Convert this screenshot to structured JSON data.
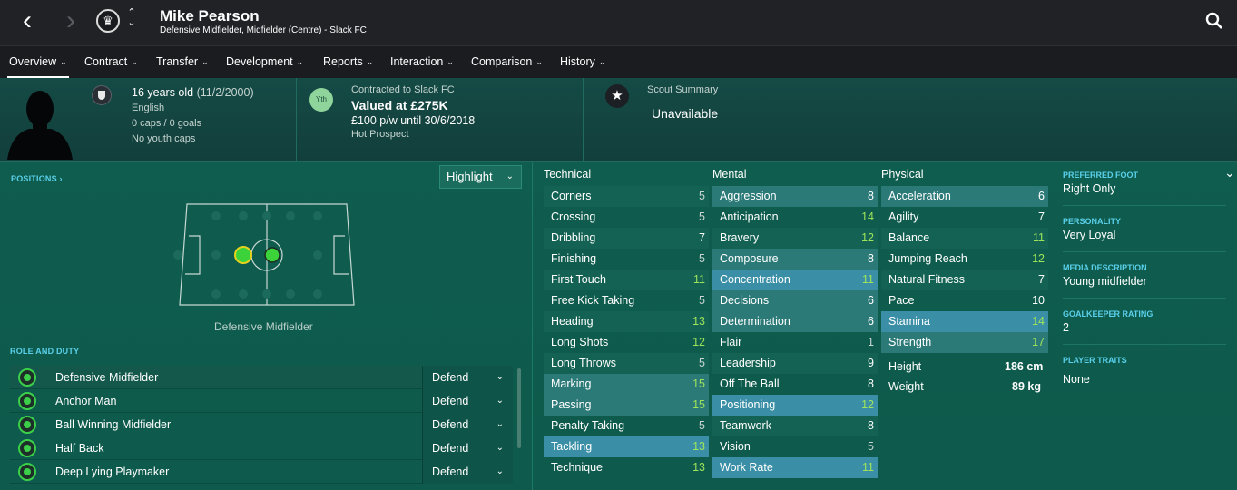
{
  "header": {
    "player_name": "Mike Pearson",
    "subtitle": "Defensive Midfielder, Midfielder (Centre) - Slack FC"
  },
  "tabs": [
    {
      "label": "Overview"
    },
    {
      "label": "Contract"
    },
    {
      "label": "Transfer"
    },
    {
      "label": "Development"
    },
    {
      "label": "Reports"
    },
    {
      "label": "Interaction"
    },
    {
      "label": "Comparison"
    },
    {
      "label": "History"
    }
  ],
  "info": {
    "age": "16 years old",
    "dob": "(11/2/2000)",
    "nationality": "English",
    "caps": "0 caps / 0 goals",
    "youth_caps": "No youth caps",
    "contract_label": "Contracted to Slack FC",
    "value": "Valued at £275K",
    "wage": "£100 p/w until 30/6/2018",
    "status": "Hot Prospect",
    "yth_badge": "Yth",
    "scout_label": "Scout Summary",
    "scout_value": "Unavailable"
  },
  "positions": {
    "heading": "POSITIONS",
    "highlight_label": "Highlight",
    "position_label": "Defensive Midfielder"
  },
  "roles": {
    "heading": "ROLE AND DUTY",
    "items": [
      {
        "name": "Defensive Midfielder",
        "duty": "Defend"
      },
      {
        "name": "Anchor Man",
        "duty": "Defend"
      },
      {
        "name": "Ball Winning Midfielder",
        "duty": "Defend"
      },
      {
        "name": "Half Back",
        "duty": "Defend"
      },
      {
        "name": "Deep Lying Playmaker",
        "duty": "Defend"
      }
    ]
  },
  "attributes": {
    "technical_heading": "Technical",
    "mental_heading": "Mental",
    "physical_heading": "Physical",
    "technical": [
      {
        "name": "Corners",
        "value": "5"
      },
      {
        "name": "Crossing",
        "value": "5"
      },
      {
        "name": "Dribbling",
        "value": "7"
      },
      {
        "name": "Finishing",
        "value": "5"
      },
      {
        "name": "First Touch",
        "value": "11"
      },
      {
        "name": "Free Kick Taking",
        "value": "5"
      },
      {
        "name": "Heading",
        "value": "13"
      },
      {
        "name": "Long Shots",
        "value": "12"
      },
      {
        "name": "Long Throws",
        "value": "5"
      },
      {
        "name": "Marking",
        "value": "15"
      },
      {
        "name": "Passing",
        "value": "15"
      },
      {
        "name": "Penalty Taking",
        "value": "5"
      },
      {
        "name": "Tackling",
        "value": "13"
      },
      {
        "name": "Technique",
        "value": "13"
      }
    ],
    "mental": [
      {
        "name": "Aggression",
        "value": "8"
      },
      {
        "name": "Anticipation",
        "value": "14"
      },
      {
        "name": "Bravery",
        "value": "12"
      },
      {
        "name": "Composure",
        "value": "8"
      },
      {
        "name": "Concentration",
        "value": "11"
      },
      {
        "name": "Decisions",
        "value": "6"
      },
      {
        "name": "Determination",
        "value": "6"
      },
      {
        "name": "Flair",
        "value": "1"
      },
      {
        "name": "Leadership",
        "value": "9"
      },
      {
        "name": "Off The Ball",
        "value": "8"
      },
      {
        "name": "Positioning",
        "value": "12"
      },
      {
        "name": "Teamwork",
        "value": "8"
      },
      {
        "name": "Vision",
        "value": "5"
      },
      {
        "name": "Work Rate",
        "value": "11"
      }
    ],
    "physical": [
      {
        "name": "Acceleration",
        "value": "6"
      },
      {
        "name": "Agility",
        "value": "7"
      },
      {
        "name": "Balance",
        "value": "11"
      },
      {
        "name": "Jumping Reach",
        "value": "12"
      },
      {
        "name": "Natural Fitness",
        "value": "7"
      },
      {
        "name": "Pace",
        "value": "10"
      },
      {
        "name": "Stamina",
        "value": "14"
      },
      {
        "name": "Strength",
        "value": "17"
      }
    ],
    "height_label": "Height",
    "height_value": "186 cm",
    "weight_label": "Weight",
    "weight_value": "89 kg"
  },
  "side": {
    "foot_heading": "PREFERRED FOOT",
    "foot_value": "Right Only",
    "personality_heading": "PERSONALITY",
    "personality_value": "Very Loyal",
    "media_heading": "MEDIA DESCRIPTION",
    "media_value": "Young midfielder",
    "gk_heading": "GOALKEEPER RATING",
    "gk_value": "2",
    "traits_heading": "PLAYER TRAITS",
    "traits_value": "None"
  },
  "colors": {
    "accent_cyan": "#5ad0ea",
    "high_value_green": "#9ee45a",
    "highlight_blue": "#3a8fa6"
  }
}
